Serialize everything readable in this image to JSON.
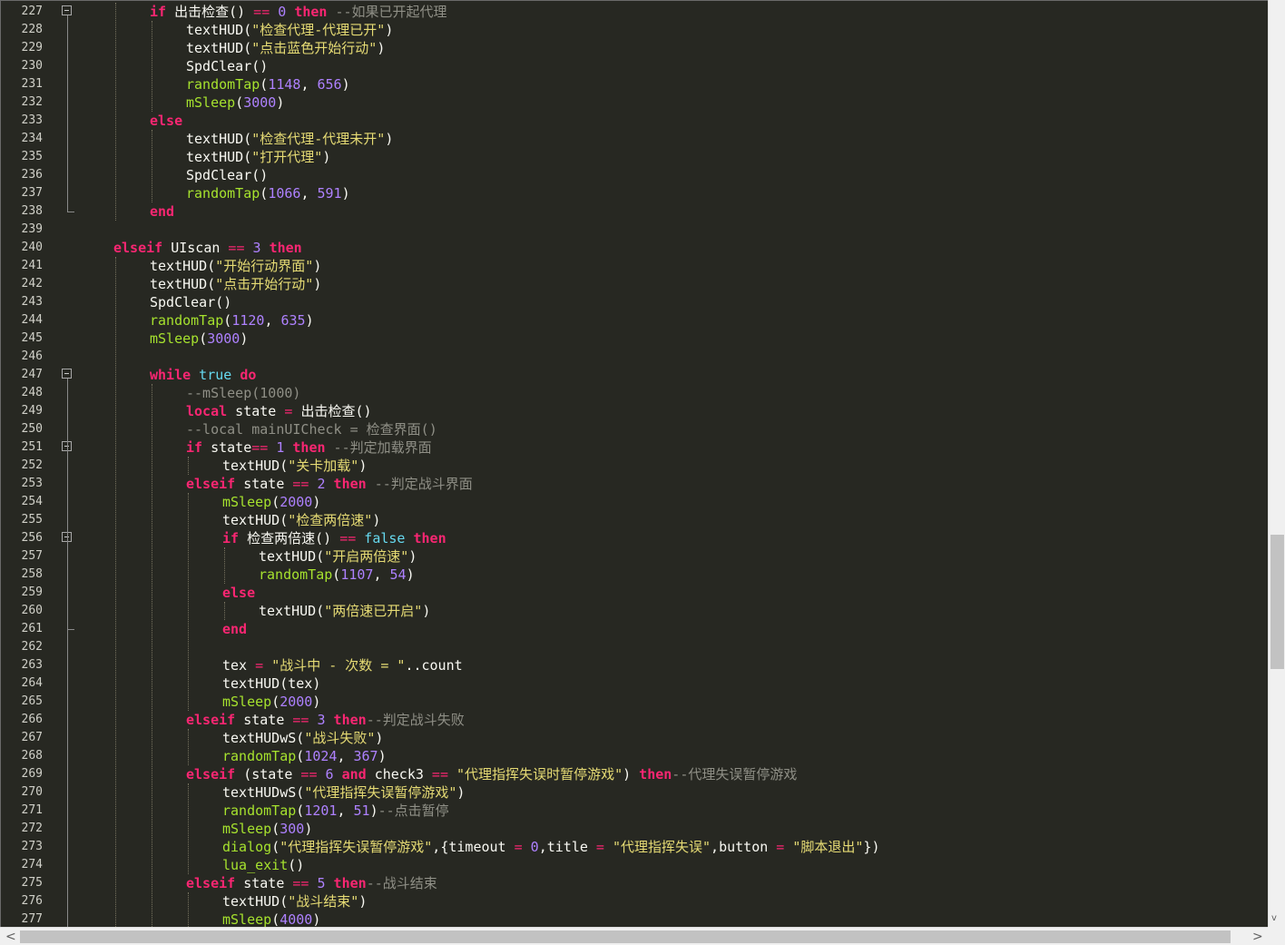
{
  "editor": {
    "lines": [
      {
        "n": "227",
        "fold": "open",
        "indent": 4,
        "tokens": [
          [
            "kw",
            "if"
          ],
          [
            "id",
            " 出击检查"
          ],
          [
            "id",
            "()"
          ],
          [
            "op",
            " == "
          ],
          [
            "num",
            "0"
          ],
          [
            "kw",
            " then"
          ],
          [
            "cm",
            " --如果已开起代理"
          ]
        ]
      },
      {
        "n": "228",
        "indent": 6,
        "tokens": [
          [
            "id",
            "textHUD"
          ],
          [
            "id",
            "("
          ],
          [
            "str",
            "\"检查代理-代理已开\""
          ],
          [
            "id",
            ")"
          ]
        ]
      },
      {
        "n": "229",
        "indent": 6,
        "tokens": [
          [
            "id",
            "textHUD"
          ],
          [
            "id",
            "("
          ],
          [
            "str",
            "\"点击蓝色开始行动\""
          ],
          [
            "id",
            ")"
          ]
        ]
      },
      {
        "n": "230",
        "indent": 6,
        "tokens": [
          [
            "id",
            "SpdClear"
          ],
          [
            "id",
            "()"
          ]
        ]
      },
      {
        "n": "231",
        "indent": 6,
        "tokens": [
          [
            "fn",
            "randomTap"
          ],
          [
            "id",
            "("
          ],
          [
            "num",
            "1148"
          ],
          [
            "id",
            ", "
          ],
          [
            "num",
            "656"
          ],
          [
            "id",
            ")"
          ]
        ]
      },
      {
        "n": "232",
        "indent": 6,
        "tokens": [
          [
            "fn",
            "mSleep"
          ],
          [
            "id",
            "("
          ],
          [
            "num",
            "3000"
          ],
          [
            "id",
            ")"
          ]
        ]
      },
      {
        "n": "233",
        "indent": 4,
        "tokens": [
          [
            "kw",
            "else"
          ]
        ]
      },
      {
        "n": "234",
        "indent": 6,
        "tokens": [
          [
            "id",
            "textHUD"
          ],
          [
            "id",
            "("
          ],
          [
            "str",
            "\"检查代理-代理未开\""
          ],
          [
            "id",
            ")"
          ]
        ]
      },
      {
        "n": "235",
        "indent": 6,
        "tokens": [
          [
            "id",
            "textHUD"
          ],
          [
            "id",
            "("
          ],
          [
            "str",
            "\"打开代理\""
          ],
          [
            "id",
            ")"
          ]
        ]
      },
      {
        "n": "236",
        "indent": 6,
        "tokens": [
          [
            "id",
            "SpdClear"
          ],
          [
            "id",
            "()"
          ]
        ]
      },
      {
        "n": "237",
        "indent": 6,
        "tokens": [
          [
            "fn",
            "randomTap"
          ],
          [
            "id",
            "("
          ],
          [
            "num",
            "1066"
          ],
          [
            "id",
            ", "
          ],
          [
            "num",
            "591"
          ],
          [
            "id",
            ")"
          ]
        ]
      },
      {
        "n": "238",
        "fold": "end",
        "indent": 4,
        "tokens": [
          [
            "kw",
            "end"
          ]
        ]
      },
      {
        "n": "239",
        "indent": 0,
        "tokens": []
      },
      {
        "n": "240",
        "indent": 2,
        "tokens": [
          [
            "kw",
            "elseif"
          ],
          [
            "id",
            " UIscan"
          ],
          [
            "op",
            " == "
          ],
          [
            "num",
            "3"
          ],
          [
            "kw",
            " then"
          ]
        ]
      },
      {
        "n": "241",
        "indent": 4,
        "tokens": [
          [
            "id",
            "textHUD"
          ],
          [
            "id",
            "("
          ],
          [
            "str",
            "\"开始行动界面\""
          ],
          [
            "id",
            ")"
          ]
        ]
      },
      {
        "n": "242",
        "indent": 4,
        "tokens": [
          [
            "id",
            "textHUD"
          ],
          [
            "id",
            "("
          ],
          [
            "str",
            "\"点击开始行动\""
          ],
          [
            "id",
            ")"
          ]
        ]
      },
      {
        "n": "243",
        "indent": 4,
        "tokens": [
          [
            "id",
            "SpdClear"
          ],
          [
            "id",
            "()"
          ]
        ]
      },
      {
        "n": "244",
        "indent": 4,
        "tokens": [
          [
            "fn",
            "randomTap"
          ],
          [
            "id",
            "("
          ],
          [
            "num",
            "1120"
          ],
          [
            "id",
            ", "
          ],
          [
            "num",
            "635"
          ],
          [
            "id",
            ")"
          ]
        ]
      },
      {
        "n": "245",
        "indent": 4,
        "tokens": [
          [
            "fn",
            "mSleep"
          ],
          [
            "id",
            "("
          ],
          [
            "num",
            "3000"
          ],
          [
            "id",
            ")"
          ]
        ]
      },
      {
        "n": "246",
        "indent": 0,
        "tokens": []
      },
      {
        "n": "247",
        "fold": "open",
        "indent": 4,
        "tokens": [
          [
            "kw",
            "while"
          ],
          [
            "bool",
            " true"
          ],
          [
            "kw",
            " do"
          ]
        ]
      },
      {
        "n": "248",
        "indent": 6,
        "tokens": [
          [
            "cm",
            "--mSleep(1000)"
          ]
        ]
      },
      {
        "n": "249",
        "indent": 6,
        "tokens": [
          [
            "kw",
            "local"
          ],
          [
            "id",
            " state"
          ],
          [
            "op",
            " = "
          ],
          [
            "id",
            "出击检查"
          ],
          [
            "id",
            "()"
          ]
        ]
      },
      {
        "n": "250",
        "indent": 6,
        "tokens": [
          [
            "cm",
            "--local mainUICheck = 检查界面()"
          ]
        ]
      },
      {
        "n": "251",
        "fold": "open",
        "indent": 6,
        "tokens": [
          [
            "kw",
            "if"
          ],
          [
            "id",
            " state"
          ],
          [
            "op",
            "=="
          ],
          [
            "num",
            " 1"
          ],
          [
            "kw",
            " then"
          ],
          [
            "cm",
            " --判定加载界面"
          ]
        ]
      },
      {
        "n": "252",
        "indent": 8,
        "tokens": [
          [
            "id",
            "textHUD"
          ],
          [
            "id",
            "("
          ],
          [
            "str",
            "\"关卡加载\""
          ],
          [
            "id",
            ")"
          ]
        ]
      },
      {
        "n": "253",
        "indent": 6,
        "tokens": [
          [
            "kw",
            "elseif"
          ],
          [
            "id",
            " state"
          ],
          [
            "op",
            " == "
          ],
          [
            "num",
            "2"
          ],
          [
            "kw",
            " then"
          ],
          [
            "cm",
            " --判定战斗界面"
          ]
        ]
      },
      {
        "n": "254",
        "indent": 8,
        "tokens": [
          [
            "fn",
            "mSleep"
          ],
          [
            "id",
            "("
          ],
          [
            "num",
            "2000"
          ],
          [
            "id",
            ")"
          ]
        ]
      },
      {
        "n": "255",
        "indent": 8,
        "tokens": [
          [
            "id",
            "textHUD"
          ],
          [
            "id",
            "("
          ],
          [
            "str",
            "\"检查两倍速\""
          ],
          [
            "id",
            ")"
          ]
        ]
      },
      {
        "n": "256",
        "fold": "open",
        "indent": 8,
        "tokens": [
          [
            "kw",
            "if"
          ],
          [
            "id",
            " 检查两倍速"
          ],
          [
            "id",
            "()"
          ],
          [
            "op",
            " == "
          ],
          [
            "bool",
            "false"
          ],
          [
            "kw",
            " then"
          ]
        ]
      },
      {
        "n": "257",
        "indent": 10,
        "tokens": [
          [
            "id",
            "textHUD"
          ],
          [
            "id",
            "("
          ],
          [
            "str",
            "\"开启两倍速\""
          ],
          [
            "id",
            ")"
          ]
        ]
      },
      {
        "n": "258",
        "indent": 10,
        "tokens": [
          [
            "fn",
            "randomTap"
          ],
          [
            "id",
            "("
          ],
          [
            "num",
            "1107"
          ],
          [
            "id",
            ", "
          ],
          [
            "num",
            "54"
          ],
          [
            "id",
            ")"
          ]
        ]
      },
      {
        "n": "259",
        "indent": 8,
        "tokens": [
          [
            "kw",
            "else"
          ]
        ]
      },
      {
        "n": "260",
        "indent": 10,
        "tokens": [
          [
            "id",
            "textHUD"
          ],
          [
            "id",
            "("
          ],
          [
            "str",
            "\"两倍速已开启\""
          ],
          [
            "id",
            ")"
          ]
        ]
      },
      {
        "n": "261",
        "fold": "end",
        "indent": 8,
        "tokens": [
          [
            "kw",
            "end"
          ]
        ]
      },
      {
        "n": "262",
        "indent": 0,
        "tokens": []
      },
      {
        "n": "263",
        "indent": 8,
        "tokens": [
          [
            "id",
            "tex"
          ],
          [
            "op",
            " = "
          ],
          [
            "str",
            "\"战斗中 - 次数 = \""
          ],
          [
            "id",
            ".."
          ],
          [
            "id",
            "count"
          ]
        ]
      },
      {
        "n": "264",
        "indent": 8,
        "tokens": [
          [
            "id",
            "textHUD"
          ],
          [
            "id",
            "("
          ],
          [
            "id",
            "tex"
          ],
          [
            "id",
            ")"
          ]
        ]
      },
      {
        "n": "265",
        "indent": 8,
        "tokens": [
          [
            "fn",
            "mSleep"
          ],
          [
            "id",
            "("
          ],
          [
            "num",
            "2000"
          ],
          [
            "id",
            ")"
          ]
        ]
      },
      {
        "n": "266",
        "indent": 6,
        "tokens": [
          [
            "kw",
            "elseif"
          ],
          [
            "id",
            " state"
          ],
          [
            "op",
            " == "
          ],
          [
            "num",
            "3"
          ],
          [
            "kw",
            " then"
          ],
          [
            "cm",
            "--判定战斗失败"
          ]
        ]
      },
      {
        "n": "267",
        "indent": 8,
        "tokens": [
          [
            "id",
            "textHUDwS"
          ],
          [
            "id",
            "("
          ],
          [
            "str",
            "\"战斗失败\""
          ],
          [
            "id",
            ")"
          ]
        ]
      },
      {
        "n": "268",
        "indent": 8,
        "tokens": [
          [
            "fn",
            "randomTap"
          ],
          [
            "id",
            "("
          ],
          [
            "num",
            "1024"
          ],
          [
            "id",
            ", "
          ],
          [
            "num",
            "367"
          ],
          [
            "id",
            ")"
          ]
        ]
      },
      {
        "n": "269",
        "indent": 6,
        "tokens": [
          [
            "kw",
            "elseif"
          ],
          [
            "id",
            " (state"
          ],
          [
            "op",
            " == "
          ],
          [
            "num",
            "6"
          ],
          [
            "kw",
            " and"
          ],
          [
            "id",
            " check3"
          ],
          [
            "op",
            " == "
          ],
          [
            "str",
            "\"代理指挥失误时暂停游戏\""
          ],
          [
            "id",
            ")"
          ],
          [
            "kw",
            " then"
          ],
          [
            "cm",
            "--代理失误暂停游戏"
          ]
        ]
      },
      {
        "n": "270",
        "indent": 8,
        "tokens": [
          [
            "id",
            "textHUDwS"
          ],
          [
            "id",
            "("
          ],
          [
            "str",
            "\"代理指挥失误暂停游戏\""
          ],
          [
            "id",
            ")"
          ]
        ]
      },
      {
        "n": "271",
        "indent": 8,
        "tokens": [
          [
            "fn",
            "randomTap"
          ],
          [
            "id",
            "("
          ],
          [
            "num",
            "1201"
          ],
          [
            "id",
            ", "
          ],
          [
            "num",
            "51"
          ],
          [
            "id",
            ")"
          ],
          [
            "cm",
            "--点击暂停"
          ]
        ]
      },
      {
        "n": "272",
        "indent": 8,
        "tokens": [
          [
            "fn",
            "mSleep"
          ],
          [
            "id",
            "("
          ],
          [
            "num",
            "300"
          ],
          [
            "id",
            ")"
          ]
        ]
      },
      {
        "n": "273",
        "indent": 8,
        "tokens": [
          [
            "fn",
            "dialog"
          ],
          [
            "id",
            "("
          ],
          [
            "str",
            "\"代理指挥失误暂停游戏\""
          ],
          [
            "id",
            ",{timeout"
          ],
          [
            "op",
            " = "
          ],
          [
            "num",
            "0"
          ],
          [
            "id",
            ",title"
          ],
          [
            "op",
            " = "
          ],
          [
            "str",
            "\"代理指挥失误\""
          ],
          [
            "id",
            ",button"
          ],
          [
            "op",
            " = "
          ],
          [
            "str",
            "\"脚本退出\""
          ],
          [
            "id",
            "})"
          ]
        ]
      },
      {
        "n": "274",
        "indent": 8,
        "tokens": [
          [
            "fn",
            "lua_exit"
          ],
          [
            "id",
            "()"
          ]
        ]
      },
      {
        "n": "275",
        "indent": 6,
        "tokens": [
          [
            "kw",
            "elseif"
          ],
          [
            "id",
            " state"
          ],
          [
            "op",
            " == "
          ],
          [
            "num",
            "5"
          ],
          [
            "kw",
            " then"
          ],
          [
            "cm",
            "--战斗结束"
          ]
        ]
      },
      {
        "n": "276",
        "indent": 8,
        "tokens": [
          [
            "id",
            "textHUD"
          ],
          [
            "id",
            "("
          ],
          [
            "str",
            "\"战斗结束\""
          ],
          [
            "id",
            ")"
          ]
        ]
      },
      {
        "n": "277",
        "indent": 8,
        "tokens": [
          [
            "fn",
            "mSleep"
          ],
          [
            "id",
            "("
          ],
          [
            "num",
            "4000"
          ],
          [
            "id",
            ")"
          ]
        ]
      }
    ]
  },
  "scrollbars": {
    "vertical_position": 0.69,
    "horizontal_position": 0.0,
    "left_arrow": "<",
    "right_arrow": ">",
    "down_arrow": "v"
  }
}
